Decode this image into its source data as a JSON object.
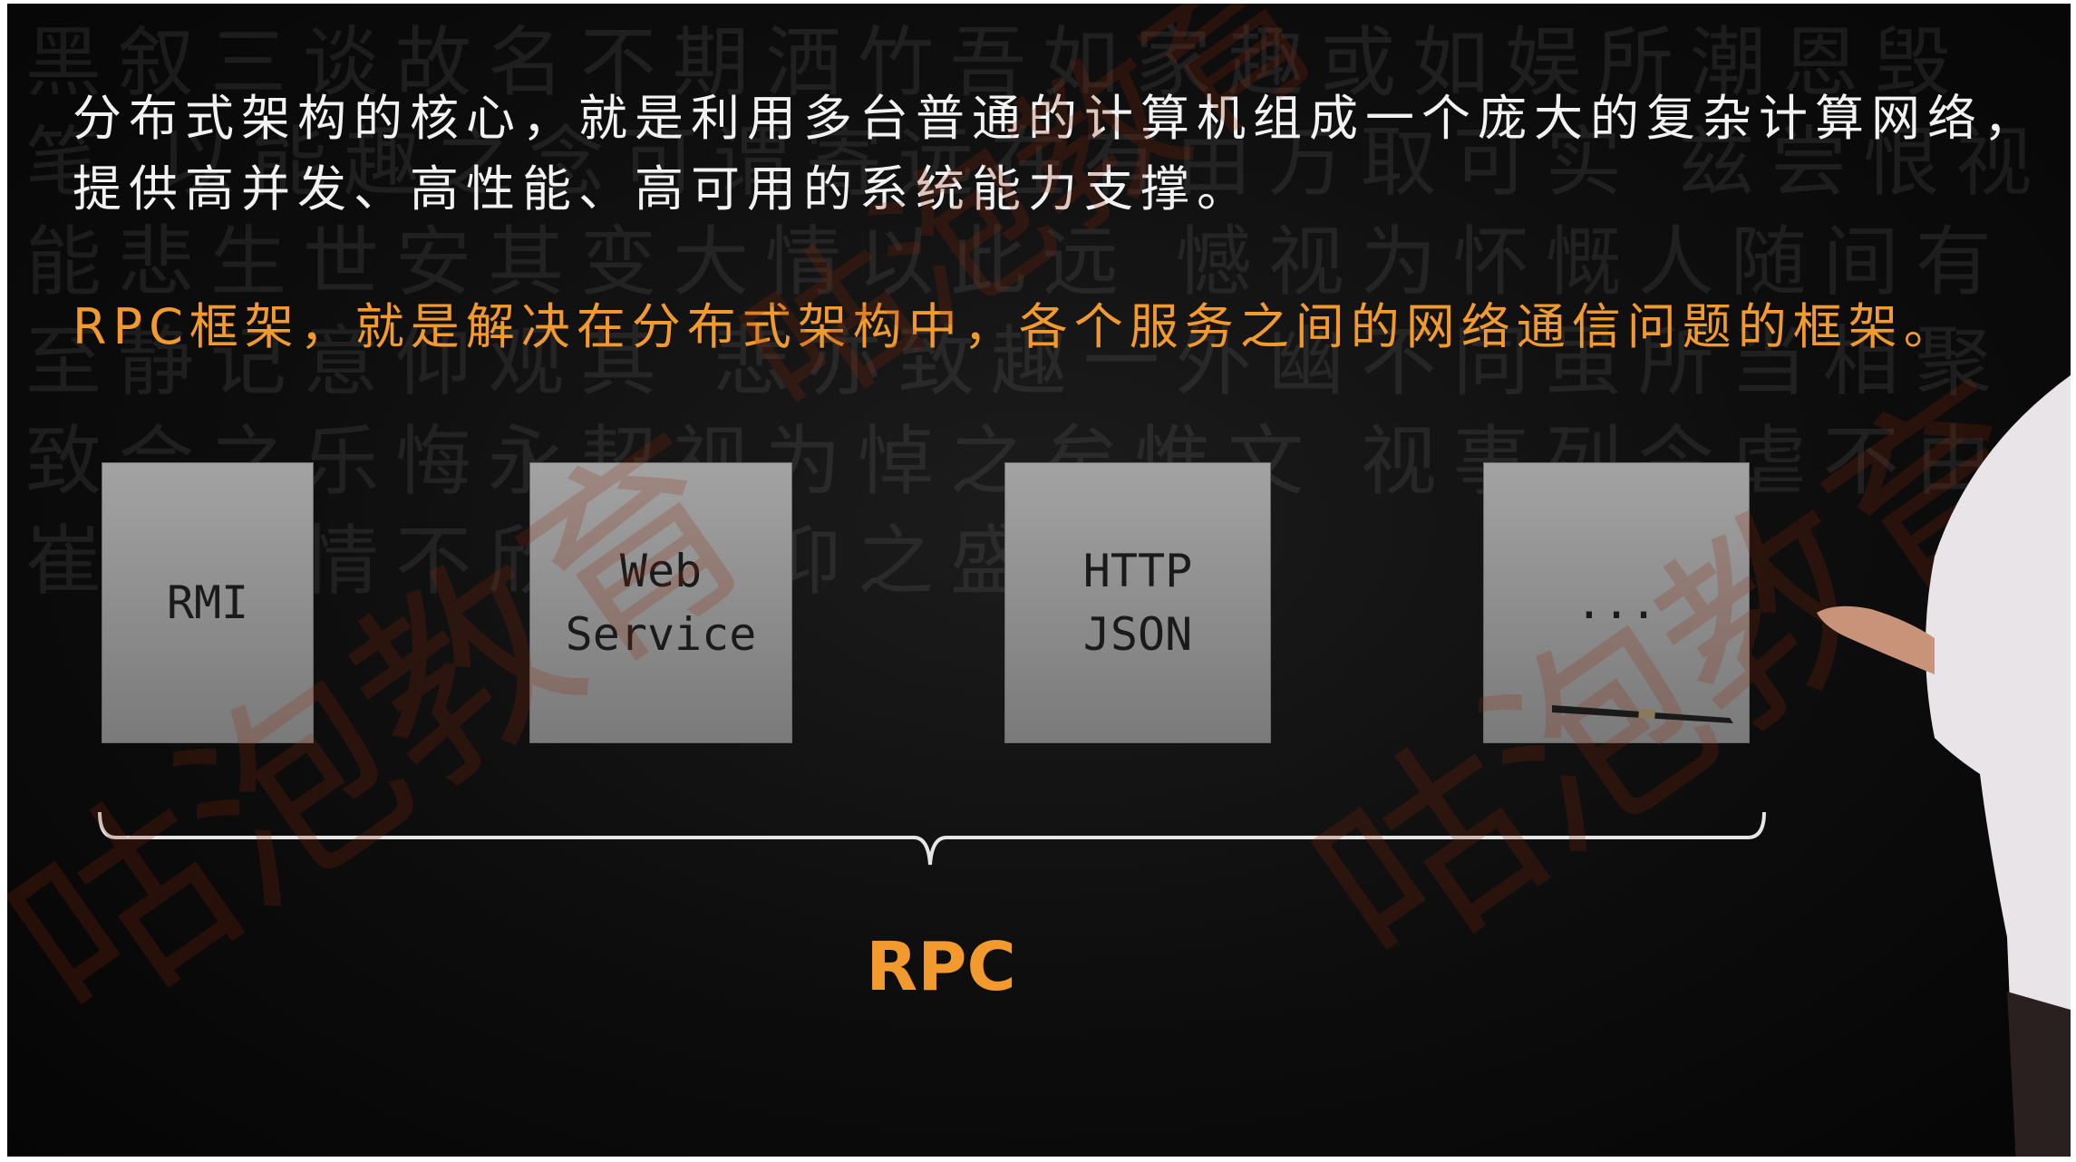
{
  "slide": {
    "line1": "分布式架构的核心，就是利用多台普通的计算机组成一个庞大的复杂计算网络，",
    "line2": "提供高并发、高性能、高可用的系统能力支撑。",
    "line3": "RPC框架，就是解决在分布式架构中，各个服务之间的网络通信问题的框架。"
  },
  "diagram": {
    "boxes": [
      {
        "label": "RMI"
      },
      {
        "label": "Web\nService"
      },
      {
        "label": "HTTP\nJSON"
      },
      {
        "label": "..."
      }
    ],
    "group_label": "RPC"
  },
  "colors": {
    "accent": "#f29a2e",
    "text": "#f2f2f2",
    "box": "#9a9a9a",
    "background": "#0d0d0d"
  }
}
